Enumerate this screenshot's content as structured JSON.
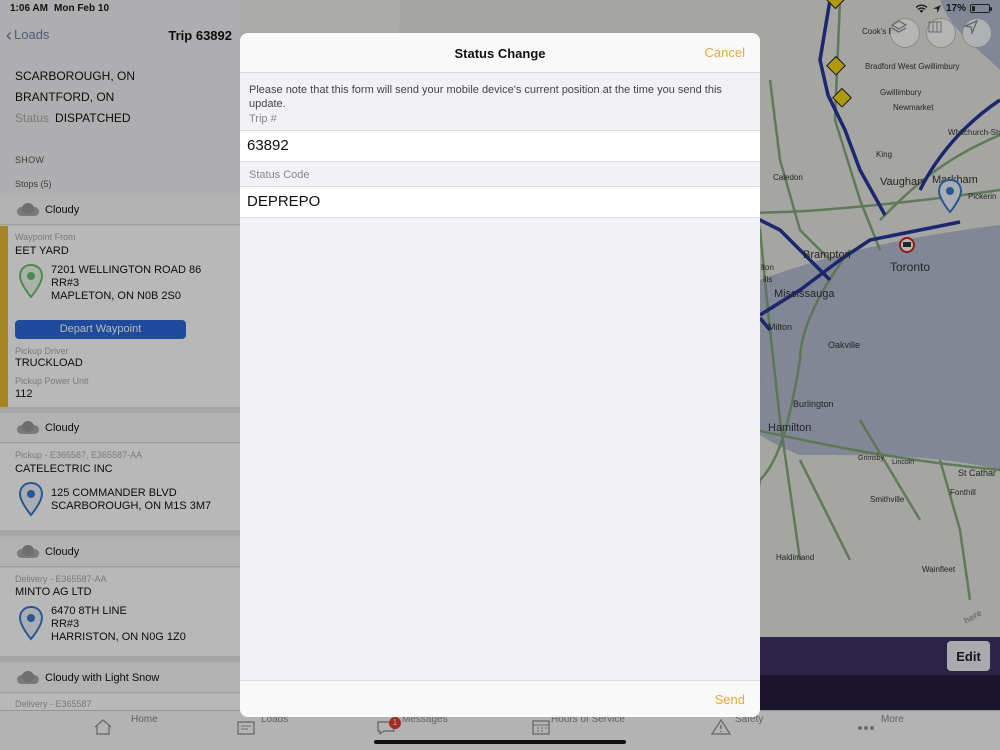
{
  "status_bar": {
    "time": "1:06 AM",
    "date": "Mon Feb 10",
    "battery": "17%",
    "battery_level": 0.17
  },
  "nav": {
    "back_label": "Loads",
    "title": "Trip 63892"
  },
  "trip": {
    "origin": "SCARBOROUGH, ON",
    "destination": "BRANTFORD, ON",
    "status_label": "Status",
    "status_value": "DISPATCHED"
  },
  "show_label": "SHOW",
  "stops_label": "Stops (5)",
  "stops": [
    {
      "weather": "Cloudy",
      "type_label": "Waypoint From",
      "company": "EET YARD",
      "address": [
        "7201 WELLINGTON ROAD 86",
        "RR#3",
        "MAPLETON, ON N0B 2S0"
      ],
      "action_label": "Depart Waypoint",
      "driver_label": "Pickup Driver",
      "driver_value": "TRUCKLOAD",
      "power_label": "Pickup Power Unit",
      "power_value": "112"
    },
    {
      "weather": "Cloudy",
      "type_label": "Pickup - E365587, E365587-AA",
      "company": "CATELECTRIC INC",
      "address": [
        "125 COMMANDER BLVD",
        "SCARBOROUGH, ON M1S 3M7"
      ]
    },
    {
      "weather": "Cloudy",
      "type_label": "Delivery - E365587-AA",
      "company": "MINTO AG LTD",
      "address": [
        "6470 8TH LINE",
        "RR#3",
        "HARRISTON, ON N0G 1Z0"
      ]
    },
    {
      "weather": "Cloudy with Light Snow",
      "type_label": "Delivery - E365587"
    }
  ],
  "map": {
    "labels": [
      "Cook's Ba",
      "Bradford West Gwillimbury",
      "Gwillimbury",
      "Newmarket",
      "Whitchurch-Stouffville",
      "King",
      "Caledon",
      "Vaughan",
      "Markham",
      "Pickerin",
      "Brampton",
      "Toronto",
      "lton",
      "ills",
      "Mississauga",
      "Milton",
      "Oakville",
      "Burlington",
      "Hamilton",
      "Grimsby",
      "Lincoln",
      "St Cathar",
      "Smithville",
      "Fonthill",
      "Haldimand",
      "Wainfleet"
    ],
    "edit_label": "Edit",
    "watermark": "here",
    "route_color": "#27369a",
    "highway_color": "#7aa36f",
    "water_color": "#b3bccd"
  },
  "modal": {
    "title": "Status Change",
    "cancel_label": "Cancel",
    "note": "Please note that this form will send your mobile device's current position at the time you send this update.",
    "trip_label": "Trip #",
    "trip_value": "63892",
    "status_code_label": "Status Code",
    "status_code_value": "DEPREPO",
    "send_label": "Send",
    "accent_color": "#e4a93a"
  },
  "tabs": [
    {
      "label": "Home",
      "icon": "home-icon"
    },
    {
      "label": "Loads",
      "icon": "loads-icon"
    },
    {
      "label": "Messages",
      "icon": "messages-icon",
      "badge": "1"
    },
    {
      "label": "Hours of Service",
      "icon": "calendar-icon"
    },
    {
      "label": "Safety",
      "icon": "warning-icon"
    },
    {
      "label": "More",
      "icon": "more-icon"
    }
  ]
}
